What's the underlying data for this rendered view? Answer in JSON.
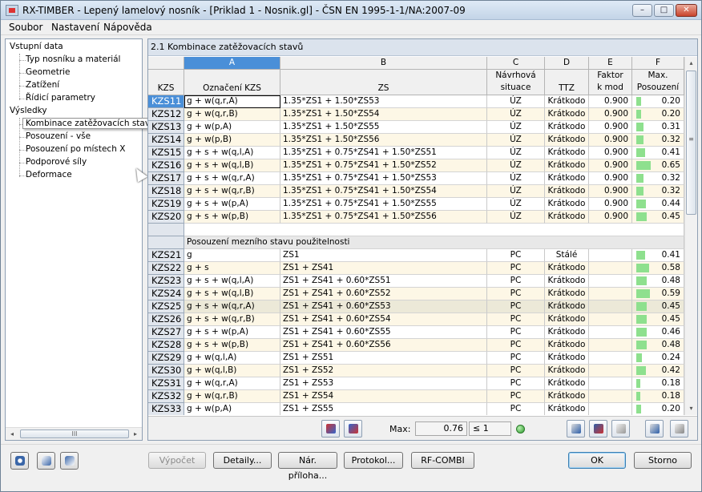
{
  "window": {
    "title": "RX-TIMBER - Lepený lamelový nosník - [Priklad 1 - Nosnik.gl] - ČSN EN 1995-1-1/NA:2007-09",
    "min_glyph": "–",
    "max_glyph": "□",
    "close_glyph": "✕"
  },
  "menu": [
    "Soubor",
    "Nastavení",
    "Nápověda"
  ],
  "nav": {
    "group1": "Vstupní data",
    "group1_items": [
      "Typ nosníku a materiál",
      "Geometrie",
      "Zatížení",
      "Řídicí parametry"
    ],
    "group2": "Výsledky",
    "group2_items": [
      "Kombinace zatěžovacích stavů",
      "Posouzení - vše",
      "Posouzení po místech X",
      "Podporové síly",
      "Deformace"
    ],
    "scroll_left": "◂",
    "scroll_right": "▸",
    "scroll_grip": "III"
  },
  "panel": {
    "title": "2.1 Kombinace zatěžovacích stavů",
    "col_letters": [
      "A",
      "B",
      "C",
      "D",
      "E",
      "F"
    ],
    "col_headers": {
      "kzs": "KZS",
      "a": "Označení KZS",
      "b": "ZS",
      "c1": "Návrhová",
      "c2": "situace",
      "d": "TTZ",
      "e1": "Faktor",
      "e2": "k mod",
      "f1": "Max.",
      "f2": "Posouzení"
    },
    "section2_title": "Posouzení mezního stavu použitelnosti",
    "rows1": [
      {
        "id": "KZS11",
        "name": "g + w(q,r,A)",
        "zs": "1.35*ZS1 + 1.50*ZS53",
        "sit": "ÚZ",
        "ttz": "Krátkodo",
        "kmod": "0.900",
        "ratio": 0.2,
        "ratio_text": "0.20"
      },
      {
        "id": "KZS12",
        "name": "g + w(q,r,B)",
        "zs": "1.35*ZS1 + 1.50*ZS54",
        "sit": "ÚZ",
        "ttz": "Krátkodo",
        "kmod": "0.900",
        "ratio": 0.2,
        "ratio_text": "0.20"
      },
      {
        "id": "KZS13",
        "name": "g + w(p,A)",
        "zs": "1.35*ZS1 + 1.50*ZS55",
        "sit": "ÚZ",
        "ttz": "Krátkodo",
        "kmod": "0.900",
        "ratio": 0.31,
        "ratio_text": "0.31"
      },
      {
        "id": "KZS14",
        "name": "g + w(p,B)",
        "zs": "1.35*ZS1 + 1.50*ZS56",
        "sit": "ÚZ",
        "ttz": "Krátkodo",
        "kmod": "0.900",
        "ratio": 0.32,
        "ratio_text": "0.32"
      },
      {
        "id": "KZS15",
        "name": "g + s + w(q,l,A)",
        "zs": "1.35*ZS1 + 0.75*ZS41 + 1.50*ZS51",
        "sit": "ÚZ",
        "ttz": "Krátkodo",
        "kmod": "0.900",
        "ratio": 0.41,
        "ratio_text": "0.41"
      },
      {
        "id": "KZS16",
        "name": "g + s + w(q,l,B)",
        "zs": "1.35*ZS1 + 0.75*ZS41 + 1.50*ZS52",
        "sit": "ÚZ",
        "ttz": "Krátkodo",
        "kmod": "0.900",
        "ratio": 0.65,
        "ratio_text": "0.65"
      },
      {
        "id": "KZS17",
        "name": "g + s + w(q,r,A)",
        "zs": "1.35*ZS1 + 0.75*ZS41 + 1.50*ZS53",
        "sit": "ÚZ",
        "ttz": "Krátkodo",
        "kmod": "0.900",
        "ratio": 0.32,
        "ratio_text": "0.32"
      },
      {
        "id": "KZS18",
        "name": "g + s + w(q,r,B)",
        "zs": "1.35*ZS1 + 0.75*ZS41 + 1.50*ZS54",
        "sit": "ÚZ",
        "ttz": "Krátkodo",
        "kmod": "0.900",
        "ratio": 0.32,
        "ratio_text": "0.32"
      },
      {
        "id": "KZS19",
        "name": "g + s + w(p,A)",
        "zs": "1.35*ZS1 + 0.75*ZS41 + 1.50*ZS55",
        "sit": "ÚZ",
        "ttz": "Krátkodo",
        "kmod": "0.900",
        "ratio": 0.44,
        "ratio_text": "0.44"
      },
      {
        "id": "KZS20",
        "name": "g + s + w(p,B)",
        "zs": "1.35*ZS1 + 0.75*ZS41 + 1.50*ZS56",
        "sit": "ÚZ",
        "ttz": "Krátkodo",
        "kmod": "0.900",
        "ratio": 0.45,
        "ratio_text": "0.45"
      }
    ],
    "rows2": [
      {
        "id": "KZS21",
        "name": "g",
        "zs": "ZS1",
        "sit": "PC",
        "ttz": "Stálé",
        "kmod": "",
        "ratio": 0.41,
        "ratio_text": "0.41"
      },
      {
        "id": "KZS22",
        "name": "g + s",
        "zs": "ZS1 + ZS41",
        "sit": "PC",
        "ttz": "Krátkodo",
        "kmod": "",
        "ratio": 0.58,
        "ratio_text": "0.58"
      },
      {
        "id": "KZS23",
        "name": "g + s + w(q,l,A)",
        "zs": "ZS1 + ZS41 + 0.60*ZS51",
        "sit": "PC",
        "ttz": "Krátkodo",
        "kmod": "",
        "ratio": 0.48,
        "ratio_text": "0.48"
      },
      {
        "id": "KZS24",
        "name": "g + s + w(q,l,B)",
        "zs": "ZS1 + ZS41 + 0.60*ZS52",
        "sit": "PC",
        "ttz": "Krátkodo",
        "kmod": "",
        "ratio": 0.59,
        "ratio_text": "0.59"
      },
      {
        "id": "KZS25",
        "name": "g + s + w(q,r,A)",
        "zs": "ZS1 + ZS41 + 0.60*ZS53",
        "sit": "PC",
        "ttz": "Krátkodo",
        "kmod": "",
        "ratio": 0.45,
        "ratio_text": "0.45"
      },
      {
        "id": "KZS26",
        "name": "g + s + w(q,r,B)",
        "zs": "ZS1 + ZS41 + 0.60*ZS54",
        "sit": "PC",
        "ttz": "Krátkodo",
        "kmod": "",
        "ratio": 0.45,
        "ratio_text": "0.45"
      },
      {
        "id": "KZS27",
        "name": "g + s + w(p,A)",
        "zs": "ZS1 + ZS41 + 0.60*ZS55",
        "sit": "PC",
        "ttz": "Krátkodo",
        "kmod": "",
        "ratio": 0.46,
        "ratio_text": "0.46"
      },
      {
        "id": "KZS28",
        "name": "g + s + w(p,B)",
        "zs": "ZS1 + ZS41 + 0.60*ZS56",
        "sit": "PC",
        "ttz": "Krátkodo",
        "kmod": "",
        "ratio": 0.48,
        "ratio_text": "0.48"
      },
      {
        "id": "KZS29",
        "name": "g + w(q,l,A)",
        "zs": "ZS1 + ZS51",
        "sit": "PC",
        "ttz": "Krátkodo",
        "kmod": "",
        "ratio": 0.24,
        "ratio_text": "0.24"
      },
      {
        "id": "KZS30",
        "name": "g + w(q,l,B)",
        "zs": "ZS1 + ZS52",
        "sit": "PC",
        "ttz": "Krátkodo",
        "kmod": "",
        "ratio": 0.42,
        "ratio_text": "0.42"
      },
      {
        "id": "KZS31",
        "name": "g + w(q,r,A)",
        "zs": "ZS1 + ZS53",
        "sit": "PC",
        "ttz": "Krátkodo",
        "kmod": "",
        "ratio": 0.18,
        "ratio_text": "0.18"
      },
      {
        "id": "KZS32",
        "name": "g + w(q,r,B)",
        "zs": "ZS1 + ZS54",
        "sit": "PC",
        "ttz": "Krátkodo",
        "kmod": "",
        "ratio": 0.18,
        "ratio_text": "0.18"
      },
      {
        "id": "KZS33",
        "name": "g + w(p,A)",
        "zs": "ZS1 + ZS55",
        "sit": "PC",
        "ttz": "Krátkodo",
        "kmod": "",
        "ratio": 0.2,
        "ratio_text": "0.20"
      }
    ],
    "vscroll_up": "▴",
    "vscroll_down": "▾",
    "vscroll_grip": "≡"
  },
  "status": {
    "max_label": "Max:",
    "max_value": "0.76",
    "limit_value": "≤ 1"
  },
  "footer": {
    "calc": "Výpočet",
    "details": "Detaily...",
    "annex": "Nár. příloha...",
    "protocol": "Protokol...",
    "rfcombi": "RF-COMBI",
    "ok": "OK",
    "cancel": "Storno"
  },
  "colors": {
    "selection": "#4a8fd8",
    "row_alt": "#fdf7e6",
    "row_highlight": "#ece9d8",
    "bar": "#8ee08e"
  }
}
